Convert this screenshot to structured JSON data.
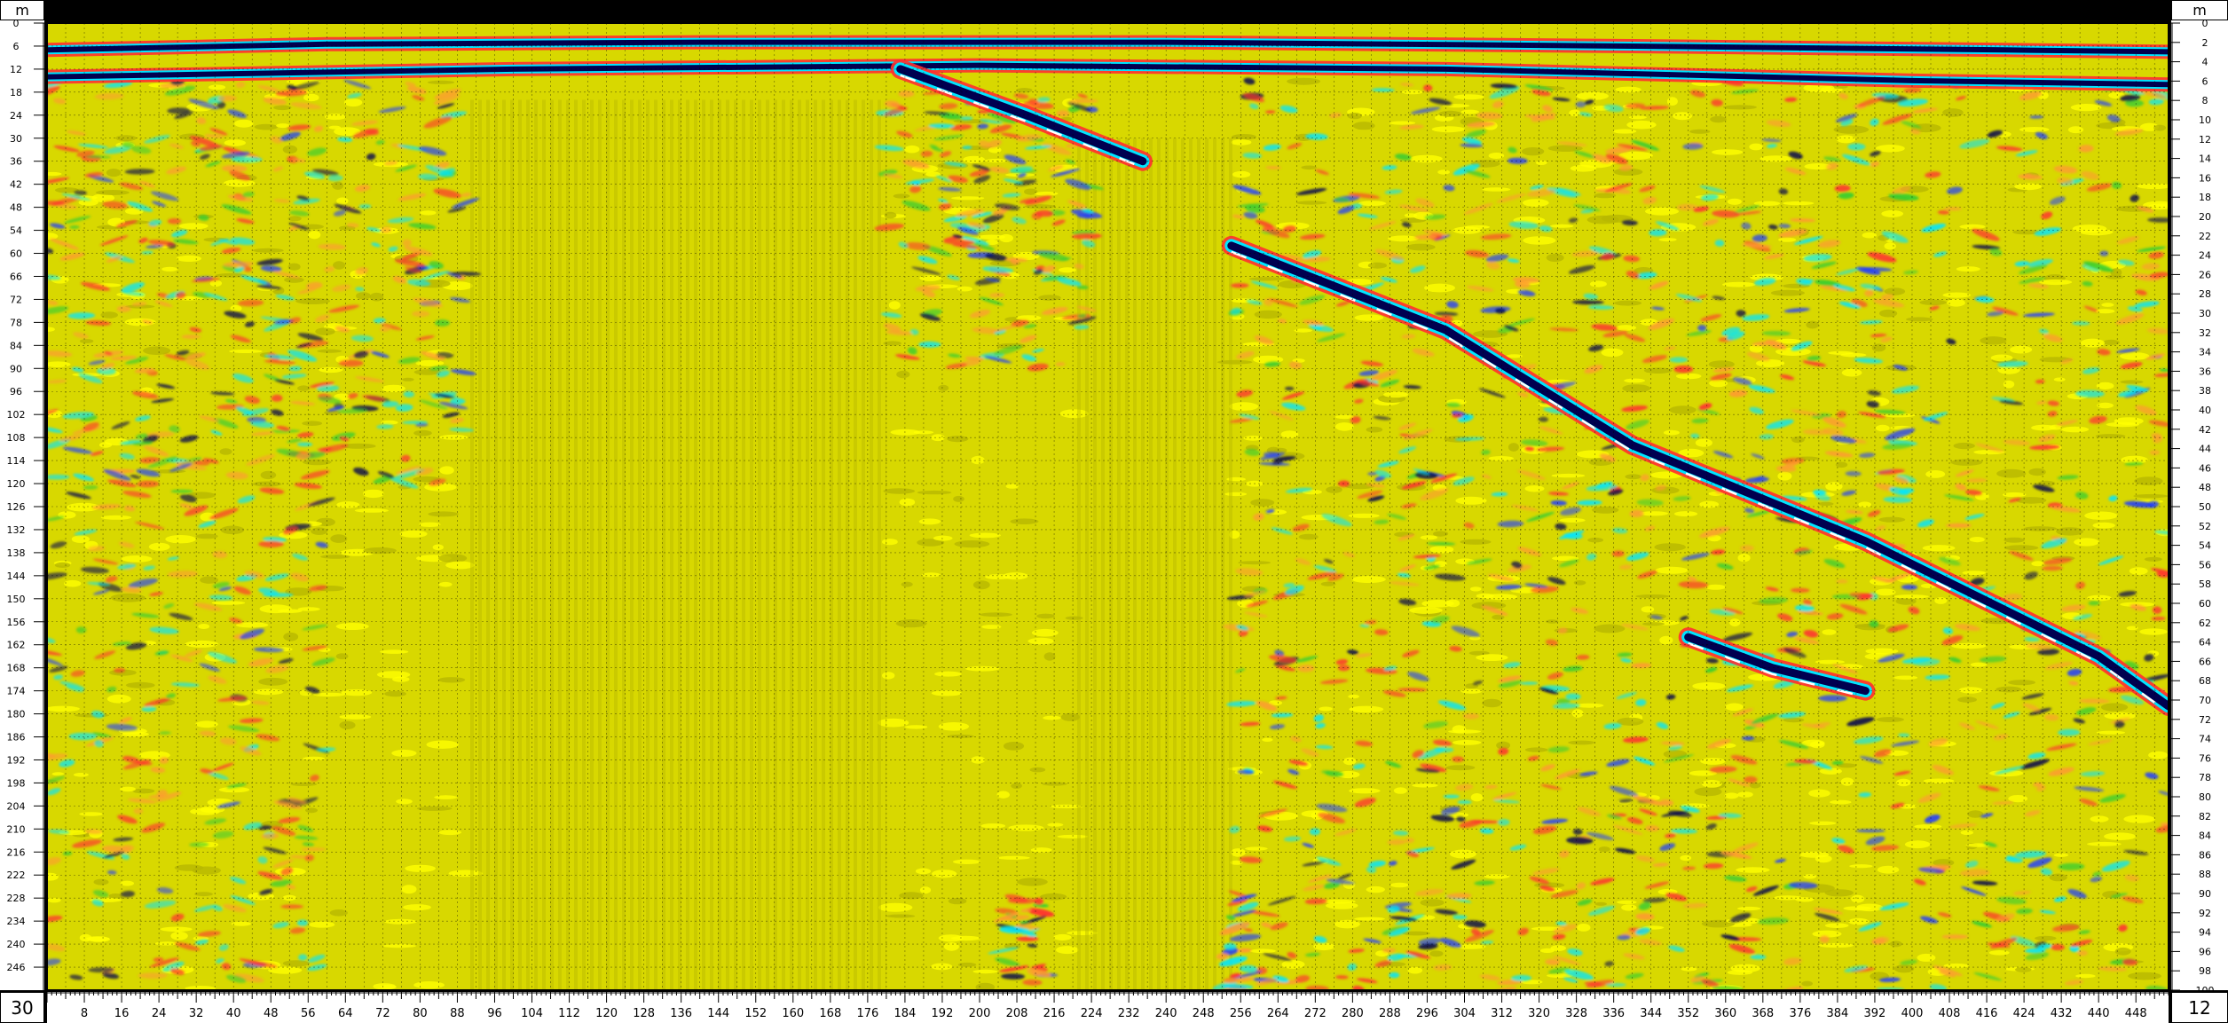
{
  "left_axis": {
    "unit": "m",
    "ticks": [
      0,
      6,
      12,
      18,
      24,
      30,
      36,
      42,
      48,
      54,
      60,
      66,
      72,
      78,
      84,
      90,
      96,
      102,
      108,
      114,
      120,
      126,
      132,
      138,
      144,
      150,
      156,
      162,
      168,
      174,
      180,
      186,
      192,
      198,
      204,
      210,
      216,
      222,
      228,
      234,
      240,
      246
    ]
  },
  "right_axis": {
    "unit": "m",
    "ticks": [
      0,
      2,
      4,
      6,
      8,
      10,
      12,
      14,
      16,
      18,
      20,
      22,
      24,
      26,
      28,
      30,
      32,
      34,
      36,
      38,
      40,
      42,
      44,
      46,
      48,
      50,
      52,
      54,
      56,
      58,
      60,
      62,
      64,
      66,
      68,
      70,
      72,
      74,
      76,
      78,
      80,
      82,
      84,
      86,
      88,
      90,
      92,
      94,
      96,
      98,
      100
    ]
  },
  "bottom_axis": {
    "ticks": [
      8,
      16,
      24,
      32,
      40,
      48,
      56,
      64,
      72,
      80,
      88,
      96,
      104,
      112,
      120,
      128,
      136,
      144,
      152,
      160,
      168,
      176,
      184,
      192,
      200,
      208,
      216,
      224,
      232,
      240,
      248,
      256,
      264,
      272,
      280,
      288,
      296,
      304,
      312,
      320,
      328,
      336,
      344,
      352,
      360,
      368,
      376,
      384,
      392,
      400,
      408,
      416,
      424,
      432,
      440,
      448
    ]
  },
  "corner_left_label": "30",
  "corner_right_label": "12",
  "chart_data": {
    "type": "heatmap",
    "title": "",
    "x_range": [
      0,
      455
    ],
    "y_left_range": [
      0,
      252
    ],
    "y_right_range": [
      0,
      100
    ],
    "y_inverted": true,
    "grid": true,
    "colors": {
      "background": "#d8d800",
      "bright_yellow": "#ffff00",
      "olive": "#b8b800",
      "orange": "#ff9933",
      "red": "#ff3030",
      "cyan": "#00e5ff",
      "blue": "#1e3cff",
      "navy": "#000050",
      "green": "#33cc33",
      "white": "#ffffff"
    },
    "reflectors": [
      {
        "name": "surface",
        "points": [
          [
            0,
            7
          ],
          [
            60,
            5.5
          ],
          [
            140,
            5
          ],
          [
            240,
            5
          ],
          [
            340,
            6
          ],
          [
            420,
            7
          ],
          [
            455,
            7.5
          ]
        ]
      },
      {
        "name": "near-surface layer",
        "points": [
          [
            0,
            14
          ],
          [
            100,
            12
          ],
          [
            200,
            11
          ],
          [
            300,
            12
          ],
          [
            400,
            15
          ],
          [
            455,
            16
          ]
        ]
      },
      {
        "name": "upper dipping reflector",
        "points": [
          [
            183,
            12
          ],
          [
            210,
            24
          ],
          [
            235,
            36
          ]
        ]
      },
      {
        "name": "main dipping reflector",
        "points": [
          [
            254,
            58
          ],
          [
            300,
            80
          ],
          [
            340,
            110
          ],
          [
            390,
            135
          ],
          [
            440,
            165
          ],
          [
            455,
            178
          ]
        ]
      },
      {
        "name": "lower dipping reflector",
        "points": [
          [
            352,
            160
          ],
          [
            370,
            168
          ],
          [
            390,
            174
          ]
        ]
      }
    ],
    "quiet_zones": [
      {
        "x": [
          90,
          180
        ],
        "y": [
          20,
          252
        ]
      },
      {
        "x": [
          220,
          255
        ],
        "y": [
          30,
          252
        ]
      }
    ]
  }
}
